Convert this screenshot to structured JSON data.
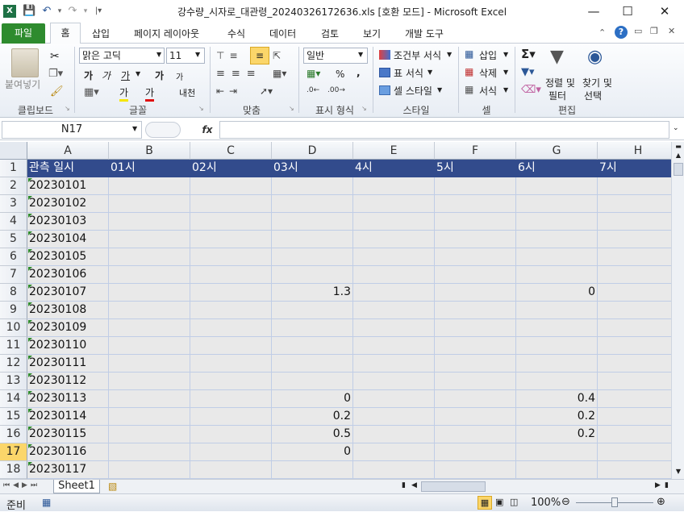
{
  "title": "강수량_시자로_대관령_20240326172636.xls  [호환 모드]  -  Microsoft Excel",
  "app_icon_letter": "X",
  "tabs": [
    "파일",
    "홈",
    "삽입",
    "페이지 레이아웃",
    "수식",
    "데이터",
    "검토",
    "보기",
    "개발 도구"
  ],
  "ribbon": {
    "paste": "붙여넣기",
    "font_name": "맑은 고딕",
    "font_size": "11",
    "bold": "가",
    "italic": "가",
    "underline": "가",
    "grow_font": "가",
    "shrink_font": "가",
    "fill_color_glyph": "가",
    "font_color_glyph": "가",
    "phonetic": "내천",
    "number_format": "일반",
    "percent": "%",
    "comma": ",",
    "conditional_format": "조건부 서식",
    "format_table": "표 서식",
    "cell_styles": "셀 스타일",
    "insert": "삽입",
    "delete": "삭제",
    "format": "서식",
    "sort_filter": [
      "정렬 및",
      "필터"
    ],
    "find_select": [
      "찾기 및",
      "선택"
    ],
    "groups": [
      "클립보드",
      "글꼴",
      "맞춤",
      "표시 형식",
      "스타일",
      "셀",
      "편집"
    ]
  },
  "name_box": "N17",
  "formula": "",
  "columns": [
    "A",
    "B",
    "C",
    "D",
    "E",
    "F",
    "G",
    "H"
  ],
  "header_row": [
    "관측 일시",
    "01시",
    "02시",
    "03시",
    "4시",
    "5시",
    "6시",
    "7시"
  ],
  "rows": [
    {
      "n": "1"
    },
    {
      "n": "2",
      "a": "20230101",
      "d": "",
      "g": ""
    },
    {
      "n": "3",
      "a": "20230102",
      "d": "",
      "g": ""
    },
    {
      "n": "4",
      "a": "20230103",
      "d": "",
      "g": ""
    },
    {
      "n": "5",
      "a": "20230104",
      "d": "",
      "g": ""
    },
    {
      "n": "6",
      "a": "20230105",
      "d": "",
      "g": ""
    },
    {
      "n": "7",
      "a": "20230106",
      "d": "",
      "g": ""
    },
    {
      "n": "8",
      "a": "20230107",
      "d": "1.3",
      "g": "0"
    },
    {
      "n": "9",
      "a": "20230108",
      "d": "",
      "g": ""
    },
    {
      "n": "10",
      "a": "20230109",
      "d": "",
      "g": ""
    },
    {
      "n": "11",
      "a": "20230110",
      "d": "",
      "g": ""
    },
    {
      "n": "12",
      "a": "20230111",
      "d": "",
      "g": ""
    },
    {
      "n": "13",
      "a": "20230112",
      "d": "",
      "g": ""
    },
    {
      "n": "14",
      "a": "20230113",
      "d": "0",
      "g": "0.4"
    },
    {
      "n": "15",
      "a": "20230114",
      "d": "0.2",
      "g": "0.2"
    },
    {
      "n": "16",
      "a": "20230115",
      "d": "0.5",
      "g": "0.2"
    },
    {
      "n": "17",
      "a": "20230116",
      "d": "0",
      "g": ""
    },
    {
      "n": "18",
      "a": "20230117",
      "d": "",
      "g": ""
    }
  ],
  "sheet_tab": "Sheet1",
  "status": "준비",
  "zoom": "100%",
  "colors": {
    "header_fill": "#324b8c",
    "cell_fill": "#e9e9e9",
    "file_tab": "#2e8b2e"
  }
}
